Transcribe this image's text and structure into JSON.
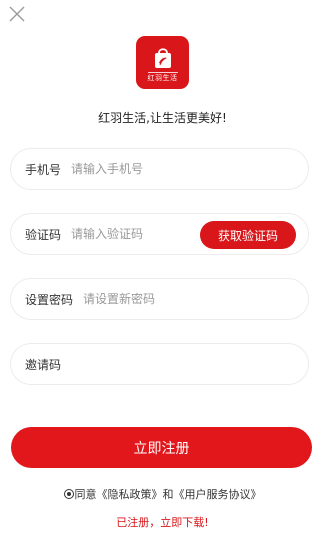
{
  "app": {
    "logo_text": "红羽生活",
    "tagline": "红羽生活,让生活更美好!"
  },
  "form": {
    "phone": {
      "label": "手机号",
      "placeholder": "请输入手机号",
      "value": ""
    },
    "code": {
      "label": "验证码",
      "placeholder": "请输入验证码",
      "value": "",
      "button": "获取验证码"
    },
    "password": {
      "label": "设置密码",
      "placeholder": "请设置新密码",
      "value": ""
    },
    "invite": {
      "label": "邀请码",
      "placeholder": "",
      "value": ""
    }
  },
  "submit_label": "立即注册",
  "agreement": {
    "prefix": "同意",
    "privacy": "《隐私政策》",
    "and": "和",
    "service": "《用户服务协议》"
  },
  "login_link": "已注册，立即下载!",
  "colors": {
    "brand": "#d9161a"
  },
  "icons": {
    "close": "close-icon",
    "logo": "shopping-bag-icon"
  }
}
